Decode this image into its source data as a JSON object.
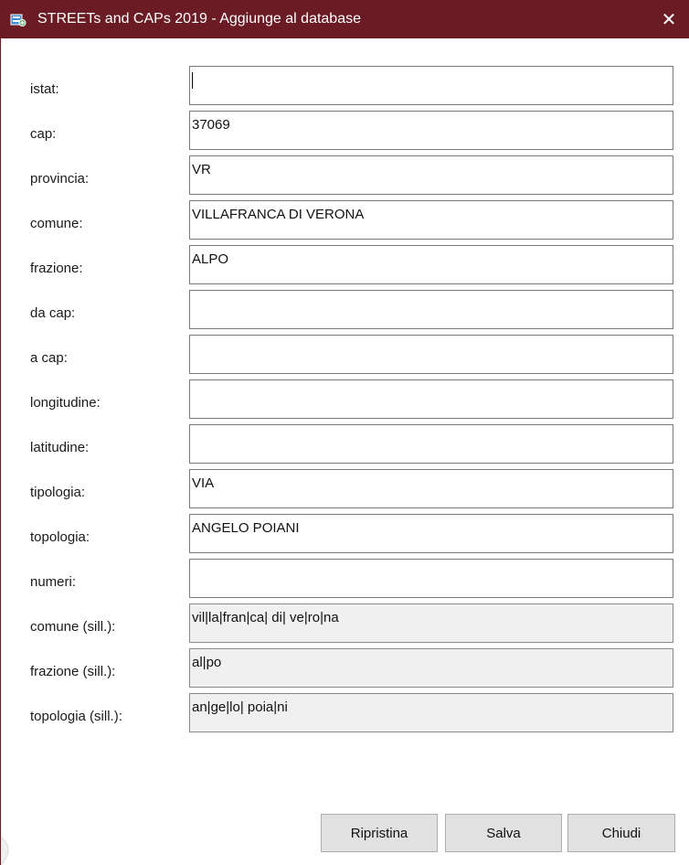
{
  "window": {
    "title": "STREETs and CAPs 2019 - Aggiunge al database",
    "close_symbol": "✕",
    "icon": "app-database-icon",
    "title_bar_color": "#6a1b24"
  },
  "form": {
    "fields": [
      {
        "label": "istat:",
        "value": "",
        "readonly": false,
        "focused": true
      },
      {
        "label": "cap:",
        "value": "37069",
        "readonly": false
      },
      {
        "label": "provincia:",
        "value": "VR",
        "readonly": false
      },
      {
        "label": "comune:",
        "value": "VILLAFRANCA DI VERONA",
        "readonly": false
      },
      {
        "label": "frazione:",
        "value": "ALPO",
        "readonly": false
      },
      {
        "label": "da cap:",
        "value": "",
        "readonly": false
      },
      {
        "label": "a cap:",
        "value": "",
        "readonly": false
      },
      {
        "label": "longitudine:",
        "value": "",
        "readonly": false
      },
      {
        "label": "latitudine:",
        "value": "",
        "readonly": false
      },
      {
        "label": "tipologia:",
        "value": "VIA",
        "readonly": false
      },
      {
        "label": "topologia:",
        "value": "ANGELO POIANI",
        "readonly": false
      },
      {
        "label": "numeri:",
        "value": "",
        "readonly": false
      },
      {
        "label": "comune (sill.):",
        "value": "vil|la|fran|ca| di| ve|ro|na",
        "readonly": true
      },
      {
        "label": "frazione (sill.):",
        "value": "al|po",
        "readonly": true
      },
      {
        "label": "topologia (sill.):",
        "value": "an|ge|lo| poia|ni",
        "readonly": true
      }
    ]
  },
  "buttons": {
    "reset": "Ripristina",
    "save": "Salva",
    "close": "Chiudi"
  }
}
